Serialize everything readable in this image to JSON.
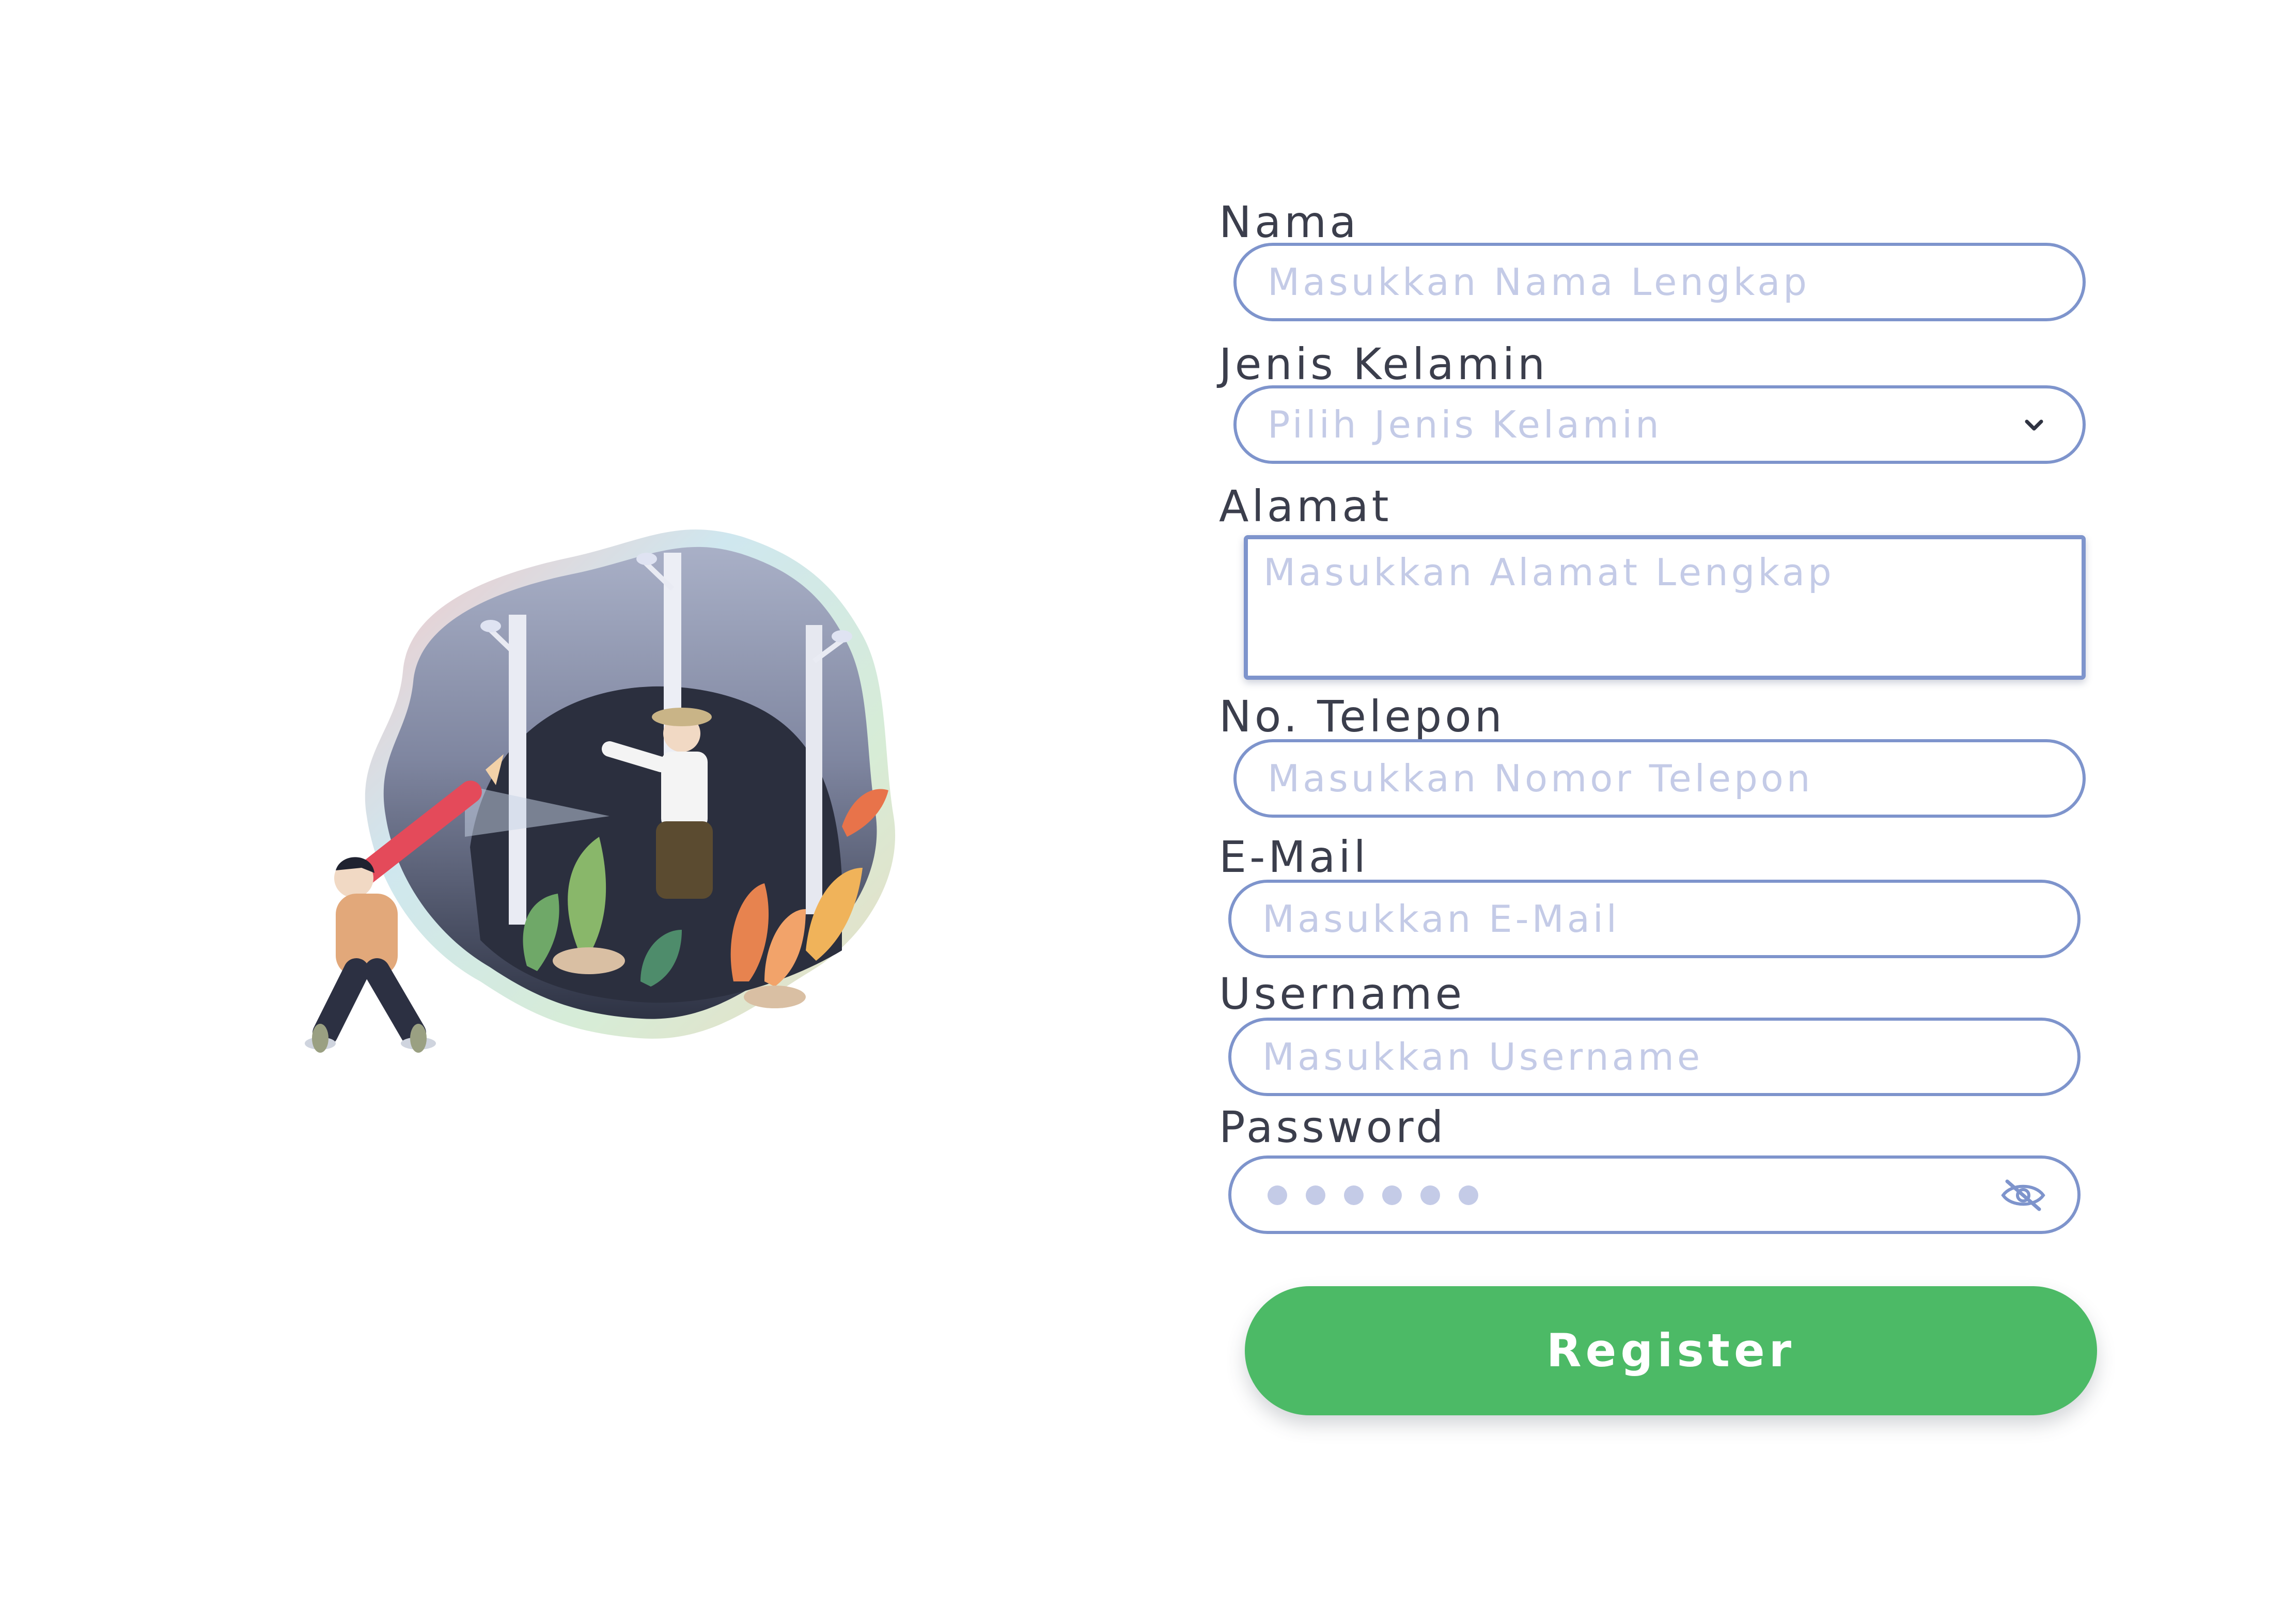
{
  "form": {
    "nama": {
      "label": "Nama",
      "placeholder": "Masukkan Nama Lengkap"
    },
    "jenis_kelamin": {
      "label": "Jenis Kelamin",
      "selected": "Pilih Jenis Kelamin"
    },
    "alamat": {
      "label": "Alamat",
      "placeholder": "Masukkan Alamat Lengkap"
    },
    "telepon": {
      "label": "No. Telepon",
      "placeholder": "Masukkan Nomor Telepon"
    },
    "email": {
      "label": "E-Mail",
      "placeholder": "Masukkan E-Mail"
    },
    "username": {
      "label": "Username",
      "placeholder": "Masukkan Username"
    },
    "password": {
      "label": "Password",
      "masked_char_count": 6
    },
    "submit_label": "Register"
  },
  "icons": {
    "dropdown": "chevron-down-icon",
    "password_toggle": "eye-off-icon"
  },
  "colors": {
    "input_border": "#7e94cc",
    "placeholder": "#c4cbe7",
    "label_text": "#3b3e4c",
    "submit_button": "#4cba66",
    "button_text": "#ffffff"
  }
}
